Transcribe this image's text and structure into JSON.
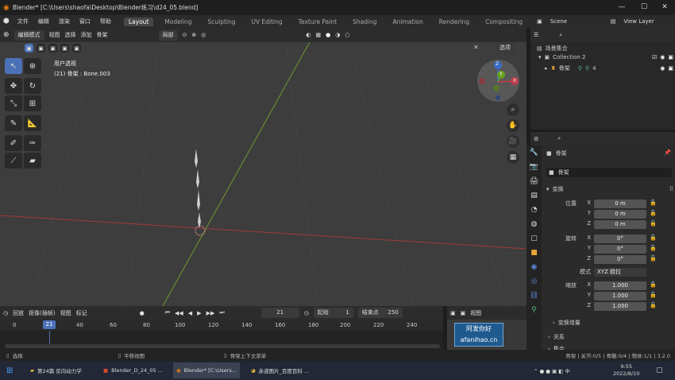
{
  "window": {
    "title": "Blender* [C:\\Users\\shaofa\\Desktop\\Blender练习\\d24_05.blend]"
  },
  "menu": {
    "items": [
      "文件",
      "编辑",
      "渲染",
      "窗口",
      "帮助"
    ]
  },
  "workspaces": [
    "Layout",
    "Modeling",
    "Sculpting",
    "UV Editing",
    "Texture Paint",
    "Shading",
    "Animation",
    "Rendering",
    "Compositing"
  ],
  "scene": {
    "name": "Scene",
    "view_layer": "View Layer"
  },
  "viewport_header": {
    "mode": "编辑模式",
    "view": "视图",
    "select": "选择",
    "add": "添加",
    "armature": "骨架",
    "orientation": "局部",
    "options": "选项"
  },
  "viewport": {
    "view_label": "用户透视",
    "object_info": "(21) 骨架 : Bone.003"
  },
  "gizmo": {
    "z": "Z",
    "y": "Y",
    "x": "X"
  },
  "outliner": {
    "root": "场景集合",
    "collection": "Collection 2",
    "item": "骨架",
    "item_badge": "4"
  },
  "properties": {
    "object_name": "骨架",
    "data_name": "骨架",
    "section_transform": "变换",
    "location_label": "位置",
    "rotation_label": "旋转",
    "scale_label": "缩放",
    "axes": [
      "X",
      "Y",
      "Z"
    ],
    "location": [
      "0 m",
      "0 m",
      "0 m"
    ],
    "rotation": [
      "0°",
      "0°",
      "0°"
    ],
    "mode_label": "模式",
    "mode_value": "XYZ 欧拉",
    "scale": [
      "1.000",
      "1.000",
      "1.000"
    ],
    "delta": "变换增量",
    "relations": "关系",
    "collections": "集合"
  },
  "timeline": {
    "playback": "回放",
    "keying": "抠像(插帧)",
    "view": "视图",
    "marker": "标记",
    "current_frame": "21",
    "start_label": "起始",
    "start": "1",
    "end_label": "结束点",
    "end": "250",
    "ticks": [
      "0",
      "40",
      "60",
      "80",
      "100",
      "120",
      "140",
      "160",
      "180",
      "200",
      "220",
      "240"
    ],
    "playhead": "21"
  },
  "statusbar": {
    "select": "选择",
    "pan": "平移视图",
    "context": "骨架上下文菜单",
    "stats": "骨架 | 关节:0/5 | 骨骼:0/4 | 物体:1/1 | 3.2.0"
  },
  "watermark": {
    "line1": "阿发你好",
    "line2": "afanihao.cn"
  },
  "taskbar": {
    "items": [
      "第24篇 反向动力学",
      "Blender_D_24_05 ...",
      "Blender* [C:\\Users...",
      "赤道图片_百度百科 ..."
    ],
    "time": "9:55",
    "date": "2022/8/10"
  }
}
